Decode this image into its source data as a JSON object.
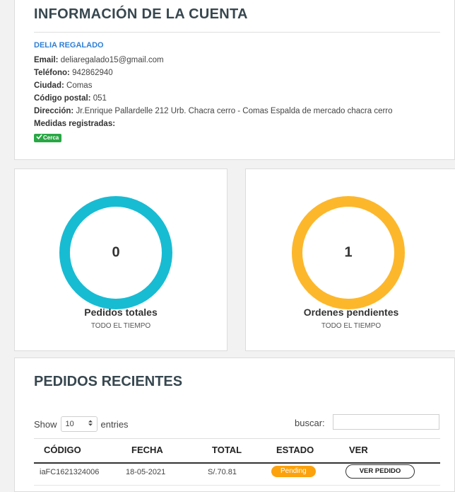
{
  "account": {
    "heading": "INFORMACIÓN DE LA CUENTA",
    "name": "DELIA REGALADO",
    "email_label": "Email:",
    "email": "deliaregalado15@gmail.com",
    "phone_label": "Teléfono:",
    "phone": "942862940",
    "city_label": "Ciudad:",
    "city": "Comas",
    "postal_label": "Código postal:",
    "postal": "051",
    "address_label": "Dirección:",
    "address": "Jr.Enrique Pallardelle 212 Urb. Chacra cerro - Comas Espalda de mercado chacra cerro",
    "measures_label": "Medidas registradas:",
    "badge": "Cerca",
    "badge_color": "#29a745"
  },
  "stats": [
    {
      "value": "0",
      "label": "Pedidos totales",
      "sub": "TODO EL TIEMPO",
      "color": "#17bcd3"
    },
    {
      "value": "1",
      "label": "Ordenes pendientes",
      "sub": "TODO EL TIEMPO",
      "color": "#fdb72b"
    }
  ],
  "orders": {
    "heading": "PEDIDOS RECIENTES",
    "show_label": "Show",
    "entries_value": "10",
    "entries_label": "entries",
    "search_label": "buscar:",
    "columns": [
      "CÓDIGO",
      "FECHA",
      "TOTAL",
      "ESTADO",
      "VER"
    ],
    "rows": [
      {
        "code": "iaFC1621324006",
        "date": "18-05-2021",
        "total": "S/.70.81",
        "status": "Pending",
        "action": "VER PEDIDO"
      }
    ],
    "status_color": "#fca20d"
  }
}
